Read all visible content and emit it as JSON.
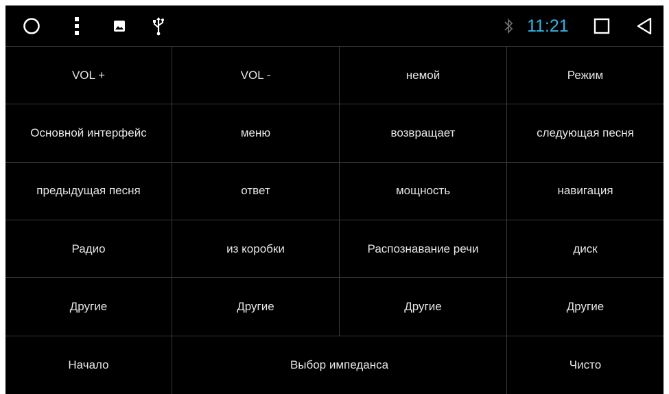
{
  "status_bar": {
    "icons": {
      "home": "circle-icon",
      "menu": "vertical-dots-icon",
      "gallery": "image-icon",
      "usb": "usb-icon",
      "bluetooth": "bluetooth-icon",
      "recents": "square-icon",
      "back": "back-triangle-icon"
    },
    "time": "11:21",
    "time_color": "#33b5e5",
    "bluetooth_color": "#6b6b6b"
  },
  "grid": {
    "rows": [
      [
        {
          "label": "VOL +"
        },
        {
          "label": "VOL -"
        },
        {
          "label": "немой"
        },
        {
          "label": "Режим"
        }
      ],
      [
        {
          "label": "Основной интерфейс"
        },
        {
          "label": "меню"
        },
        {
          "label": "возвращает"
        },
        {
          "label": "следующая песня"
        }
      ],
      [
        {
          "label": "предыдущая песня"
        },
        {
          "label": "ответ"
        },
        {
          "label": "мощность"
        },
        {
          "label": "навигация"
        }
      ],
      [
        {
          "label": "Радио"
        },
        {
          "label": "из коробки"
        },
        {
          "label": "Распознавание речи"
        },
        {
          "label": "диск"
        }
      ],
      [
        {
          "label": "Другие"
        },
        {
          "label": "Другие"
        },
        {
          "label": "Другие"
        },
        {
          "label": "Другие"
        }
      ],
      [
        {
          "label": "Начало"
        },
        {
          "label": "Выбор импеданса"
        },
        {
          "label": "Чисто"
        }
      ]
    ]
  },
  "colors": {
    "background": "#000000",
    "grid_line": "#3a3a3a",
    "text": "#e6e6e6"
  }
}
